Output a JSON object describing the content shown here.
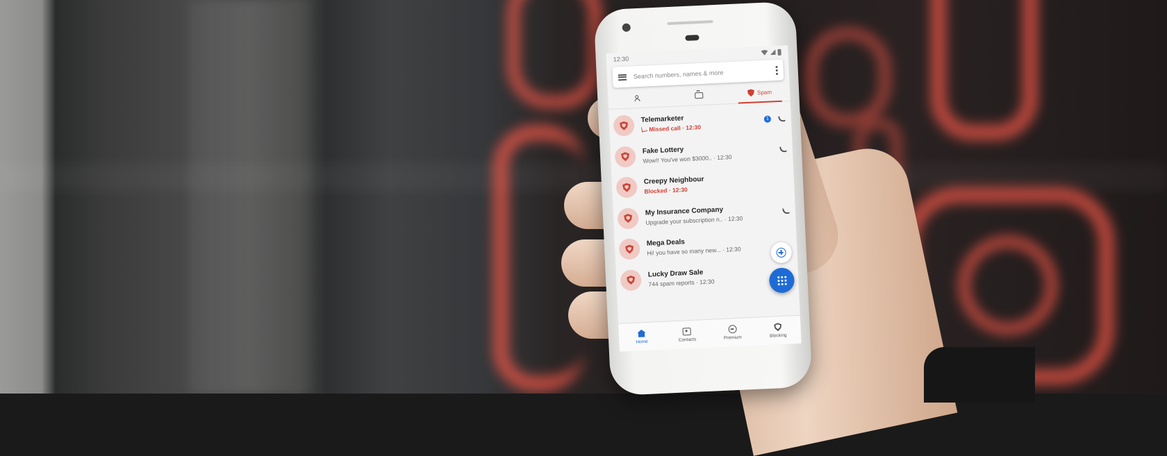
{
  "status_bar": {
    "time": "12:30"
  },
  "search": {
    "placeholder": "Search numbers, names & more"
  },
  "tabs": [
    {
      "icon": "people-icon",
      "label": ""
    },
    {
      "icon": "briefcase-icon",
      "label": ""
    },
    {
      "icon": "shield-icon",
      "label": "Spam"
    }
  ],
  "calls": [
    {
      "name": "Telemarketer",
      "subtitle": "Missed call · 12:30",
      "badge": "1",
      "style": "missed"
    },
    {
      "name": "Fake Lottery",
      "subtitle": "Wow!! You've won $3000.. · 12:30",
      "style": "normal"
    },
    {
      "name": "Creepy Neighbour",
      "subtitle": "Blocked · 12:30",
      "style": "blocked"
    },
    {
      "name": "My Insurance Company",
      "subtitle": "Upgrade your subscription n.. · 12:30",
      "style": "normal"
    },
    {
      "name": "Mega Deals",
      "subtitle": "Hi! you have so many new... · 12:30",
      "style": "normal"
    },
    {
      "name": "Lucky Draw Sale",
      "subtitle": "744 spam reports · 12:30",
      "style": "normal"
    }
  ],
  "bottom_nav": [
    {
      "icon": "home-icon",
      "label": "Home",
      "active": true
    },
    {
      "icon": "contacts-icon",
      "label": "Contacts"
    },
    {
      "icon": "premium-icon",
      "label": "Premium"
    },
    {
      "icon": "blocking-icon",
      "label": "Blocking"
    }
  ],
  "colors": {
    "spam_red": "#d23f31",
    "accent_blue": "#1e6bd6",
    "avatar_bg": "#f0cac4"
  }
}
